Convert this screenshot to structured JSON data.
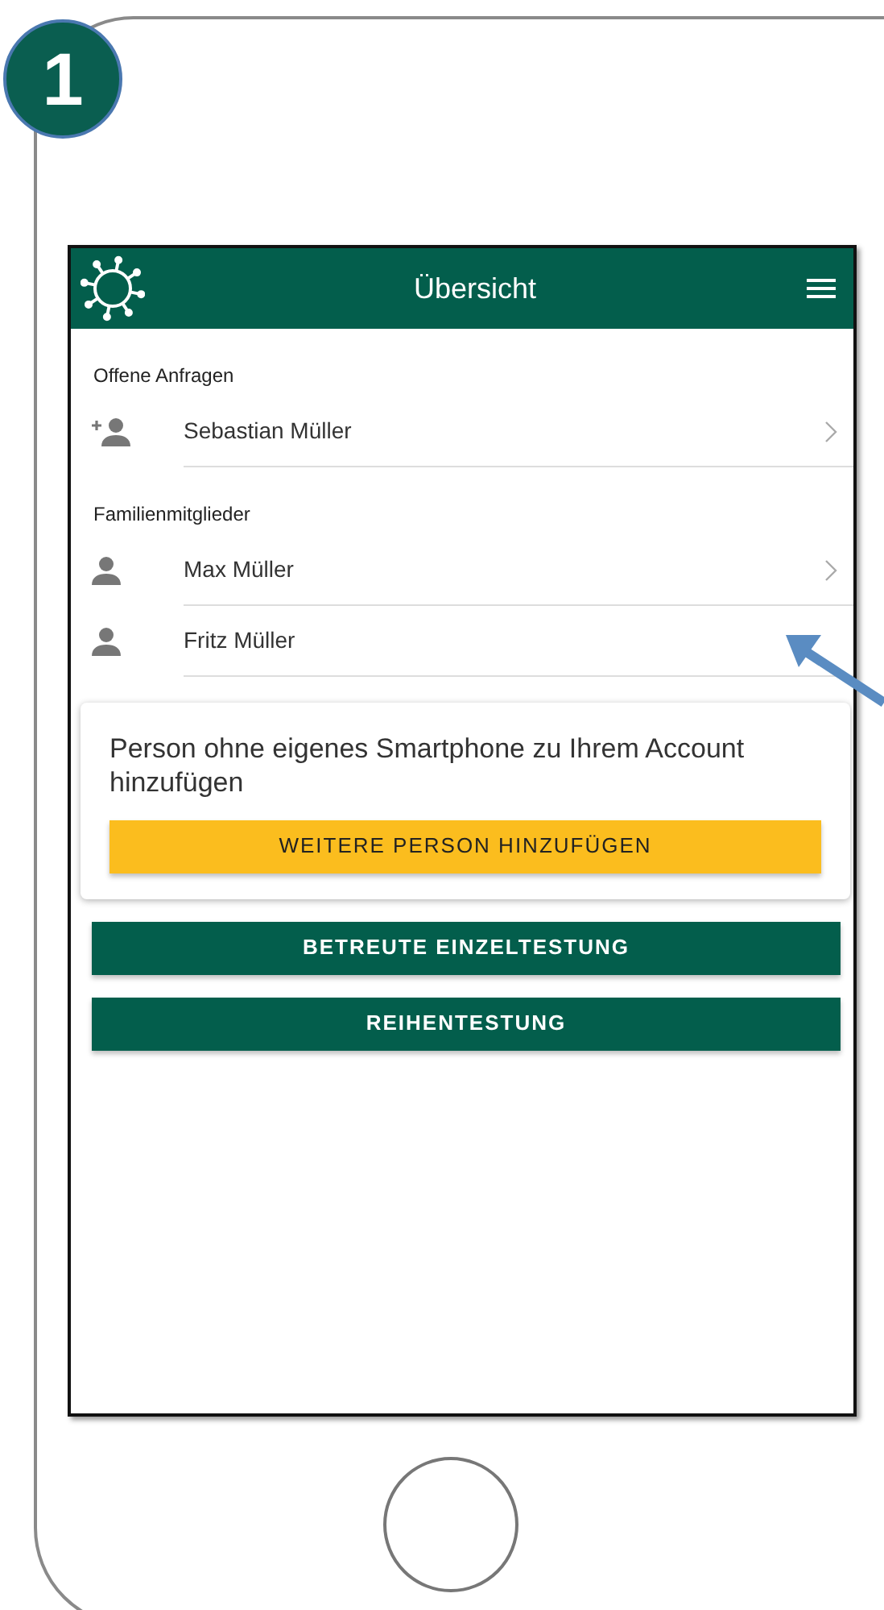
{
  "step_badge": "1",
  "app_bar": {
    "title": "Übersicht"
  },
  "sections": [
    {
      "heading": "Offene Anfragen",
      "items": [
        {
          "kind": "request",
          "name": "Sebastian Müller",
          "chevron": true
        }
      ]
    },
    {
      "heading": "Familienmitglieder",
      "items": [
        {
          "kind": "member",
          "name": "Max Müller",
          "chevron": true
        },
        {
          "kind": "member",
          "name": "Fritz Müller",
          "chevron": false
        }
      ]
    }
  ],
  "add_card": {
    "text": "Person ohne eigenes Smartphone zu Ihrem Account hinzufügen",
    "button": "WEITERE PERSON HINZUFÜGEN"
  },
  "buttons": [
    "BETREUTE EINZELTESTUNG",
    "REIHENTESTUNG"
  ]
}
